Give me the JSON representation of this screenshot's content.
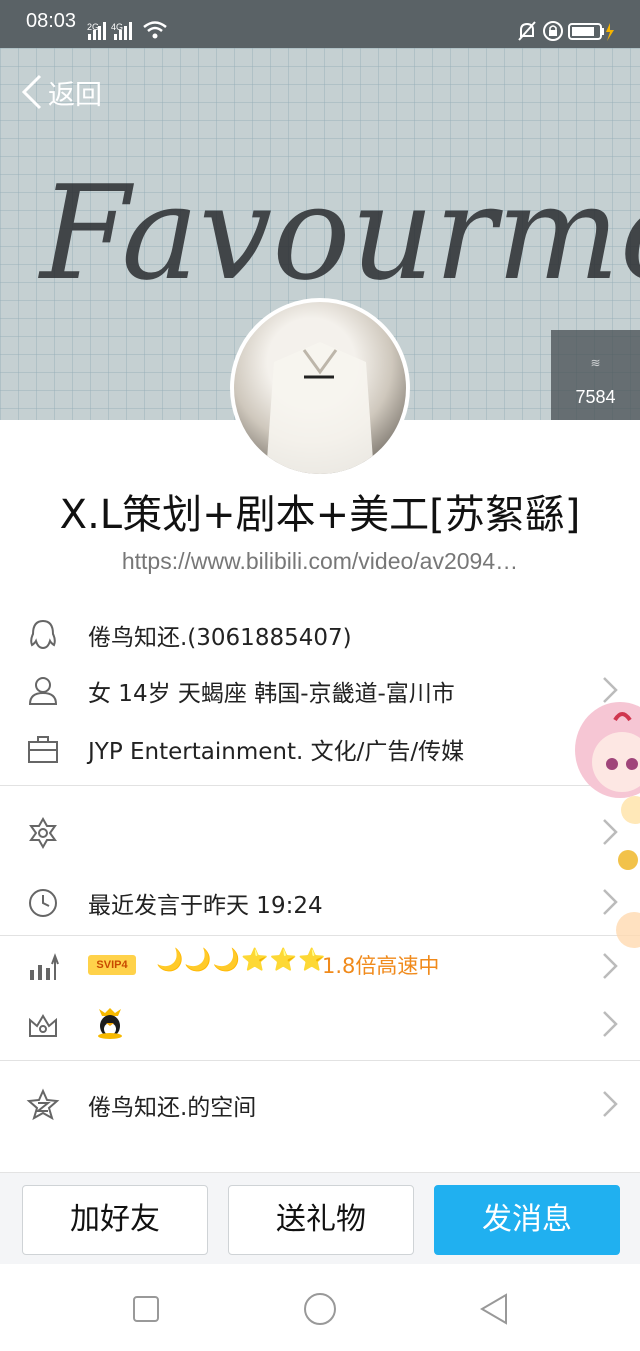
{
  "status_bar": {
    "time": "08:03",
    "network_1": "2G",
    "network_2": "4G"
  },
  "header": {
    "back_label": "返回",
    "cover_handwriting": "Favourmona.",
    "view_count": "7584"
  },
  "profile": {
    "name": "X.L策划+剧本+美工[苏絮繇]",
    "link": "https://www.bilibili.com/video/av2094…"
  },
  "info_rows": [
    {
      "icon": "qq-penguin-outline-icon",
      "text": "倦鸟知还.(3061885407)"
    },
    {
      "icon": "person-icon",
      "text": "女  14岁  天蝎座  韩国-京畿道-富川市"
    },
    {
      "icon": "briefcase-icon",
      "text": "JYP Entertainment. 文化/广告/传媒"
    }
  ],
  "detail_rows": [
    {
      "icon": "tag-star-icon",
      "text": ""
    },
    {
      "icon": "clock-icon",
      "text": "最近发言于昨天 19:24"
    }
  ],
  "level_row": {
    "icon": "level-chart-icon",
    "badge": "SVIP4",
    "level_icons": "🌙🌙🌙⭐⭐⭐",
    "speed_text": "1.8倍高速中"
  },
  "vip_row": {
    "icon": "crown-icon",
    "badge_icon": "qq-penguin-icon"
  },
  "space_row": {
    "icon": "qzone-star-icon",
    "text": "倦鸟知还.的空间"
  },
  "actions": {
    "add_friend": "加好友",
    "send_gift": "送礼物",
    "send_message": "发消息"
  },
  "colors": {
    "accent": "#20b0f0",
    "status_bar": "#5a6266",
    "speed_text": "#f08a1b"
  }
}
